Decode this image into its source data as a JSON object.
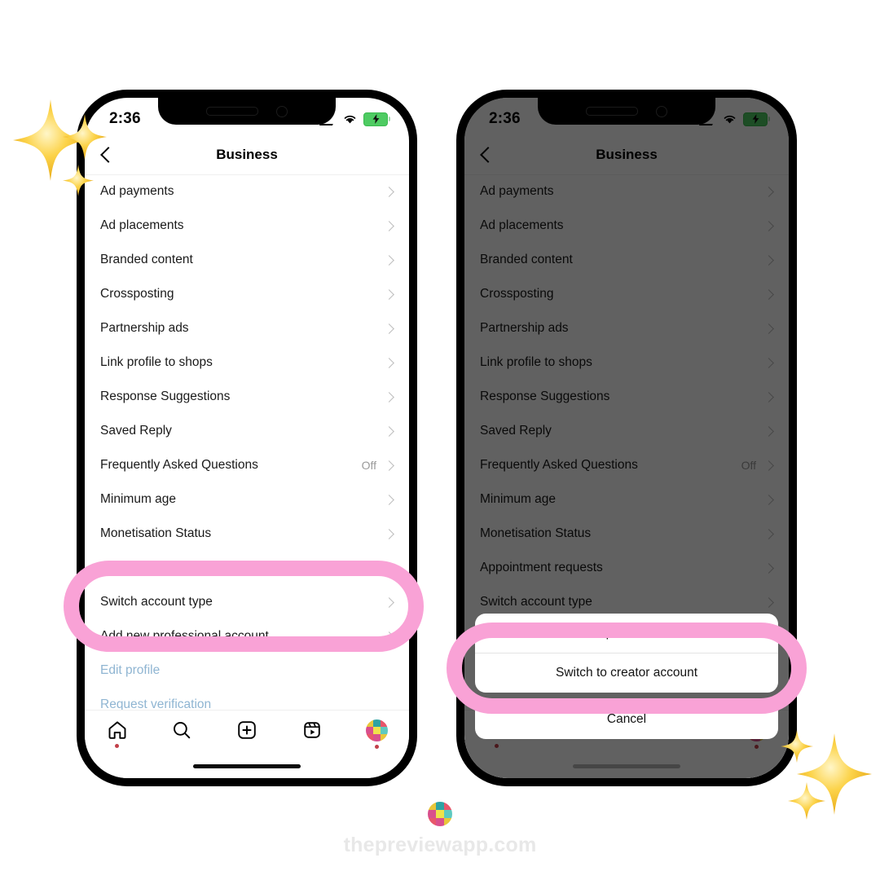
{
  "canvas": {
    "background": "#ffffff",
    "accent_pink": "#f9a2d6",
    "link_blue": "#8fb5d2",
    "dim_overlay": "rgba(0,0,0,0.62)"
  },
  "status_bar": {
    "time": "2:36",
    "wifi_icon": "wifi-icon",
    "battery_icon": "battery-charging-icon",
    "signal_icon": "signal-icon"
  },
  "nav": {
    "back_icon": "back-chevron-icon",
    "title": "Business"
  },
  "settings_rows": [
    {
      "label": "Ad payments",
      "value": ""
    },
    {
      "label": "Ad placements",
      "value": ""
    },
    {
      "label": "Branded content",
      "value": ""
    },
    {
      "label": "Crossposting",
      "value": ""
    },
    {
      "label": "Partnership ads",
      "value": ""
    },
    {
      "label": "Link profile to shops",
      "value": ""
    },
    {
      "label": "Response Suggestions",
      "value": ""
    },
    {
      "label": "Saved Reply",
      "value": ""
    },
    {
      "label": "Frequently Asked Questions",
      "value": "Off"
    },
    {
      "label": "Minimum age",
      "value": ""
    },
    {
      "label": "Monetisation Status",
      "value": ""
    },
    {
      "label": "Appointment requests",
      "value": ""
    },
    {
      "label": "Switch account type",
      "value": ""
    },
    {
      "label": "Add new professional account",
      "value": ""
    }
  ],
  "link_rows": [
    {
      "label": "Edit profile"
    },
    {
      "label": "Request verification"
    }
  ],
  "tab_bar": [
    {
      "name": "home-icon",
      "badge": true
    },
    {
      "name": "search-icon",
      "badge": false
    },
    {
      "name": "create-icon",
      "badge": false
    },
    {
      "name": "reels-icon",
      "badge": false
    },
    {
      "name": "profile-avatar-icon",
      "badge": true
    }
  ],
  "action_sheet": {
    "options": [
      {
        "label": "Switch to personal account"
      },
      {
        "label": "Switch to creator account"
      }
    ],
    "cancel_label": "Cancel"
  },
  "highlights": [
    {
      "target": "Switch account type"
    },
    {
      "target": "Switch to creator account"
    }
  ],
  "watermark": {
    "text": "thepreviewapp.com",
    "logo_icon": "preview-app-logo-icon"
  },
  "decorations": [
    {
      "name": "sparkle-group-top-left"
    },
    {
      "name": "sparkle-group-bottom-right"
    }
  ]
}
